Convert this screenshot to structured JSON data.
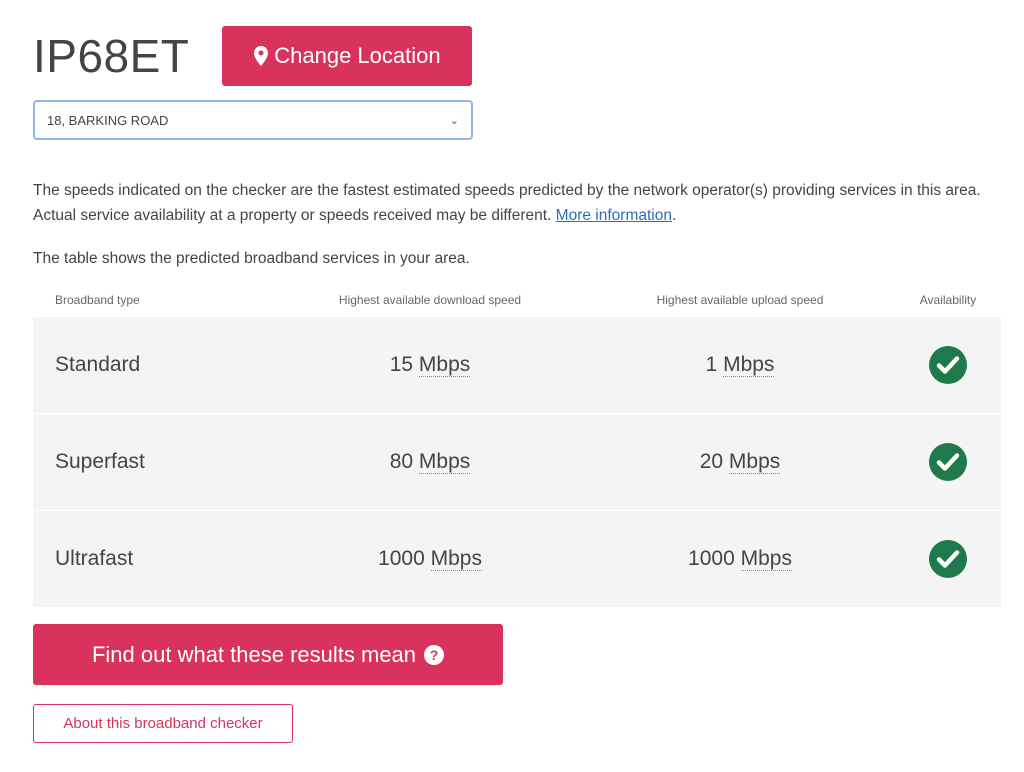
{
  "header": {
    "postcode": "IP68ET",
    "change_location_label": "Change Location",
    "change_location_icon": "map-pin-icon"
  },
  "address_select": {
    "selected_value": "18, BARKING ROAD",
    "icon": "chevron-down-icon"
  },
  "description": {
    "text": "The speeds indicated on the checker are the fastest estimated speeds predicted by the network operator(s) providing services in this area. Actual service availability at a property or speeds received may be different. ",
    "link_label": "More information",
    "trailing": "."
  },
  "table_intro": "The table shows the predicted broadband services in your area.",
  "table": {
    "headers": [
      "Broadband type",
      "Highest available download speed",
      "Highest available upload speed",
      "Availability"
    ],
    "rows": [
      {
        "type": "Standard",
        "download": "15",
        "upload": "1",
        "unit": "Mbps",
        "available": true
      },
      {
        "type": "Superfast",
        "download": "80",
        "upload": "20",
        "unit": "Mbps",
        "available": true
      },
      {
        "type": "Ultrafast",
        "download": "1000",
        "upload": "1000",
        "unit": "Mbps",
        "available": true
      }
    ],
    "availability_icon": "check-circle-icon"
  },
  "actions": {
    "results_label": "Find out what these results mean",
    "results_icon": "question-circle-icon",
    "about_label": "About this broadband checker"
  },
  "colors": {
    "accent": "#d9335d",
    "check_green": "#1e7a4a",
    "link": "#2a6ebb",
    "row_bg": "#f4f4f4"
  }
}
